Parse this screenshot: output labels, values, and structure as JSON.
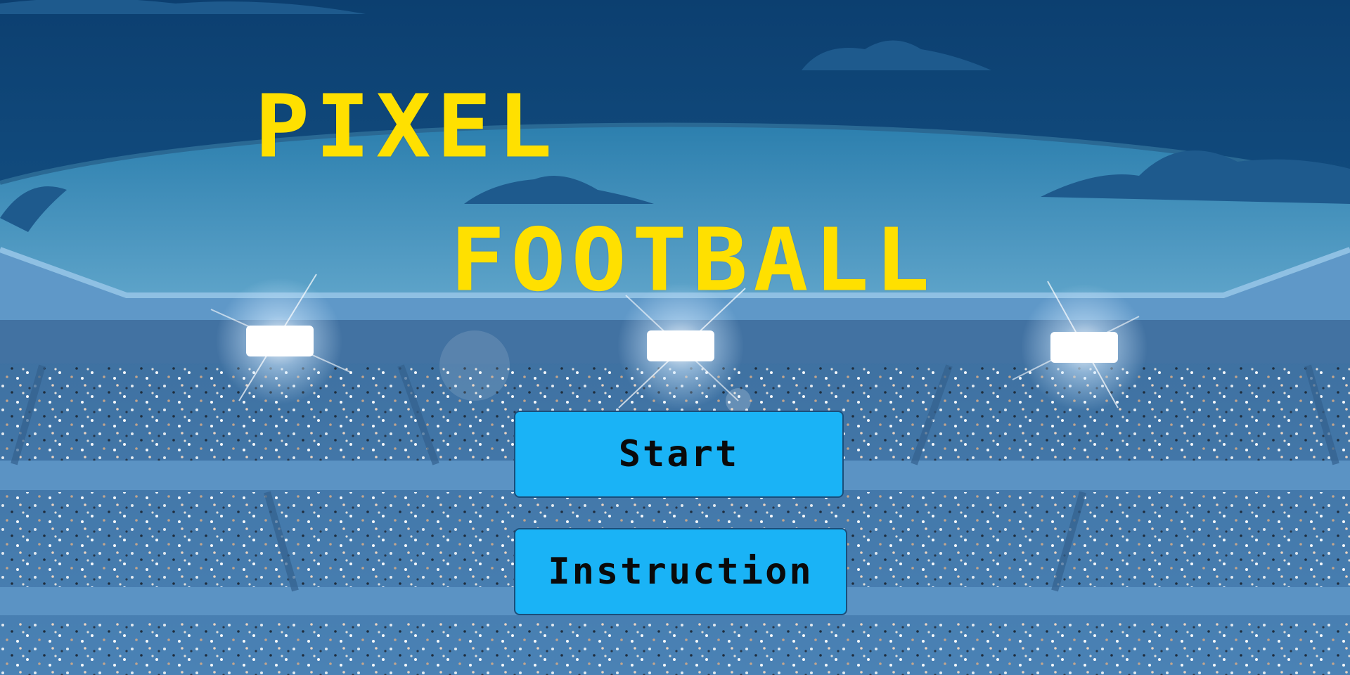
{
  "game": {
    "title_line_1": "PIXEL",
    "title_line_2": "FOOTBALL",
    "menu": {
      "start_label": "Start",
      "instruction_label": "Instruction"
    }
  },
  "colors": {
    "title": "#ffe000",
    "button_fill": "#1ab3f6",
    "button_border": "#1b4e7a",
    "button_text": "#0a0a0a",
    "sky_top": "#0d4a80",
    "stadium": "#4f86b8"
  },
  "icons": [
    "stadium-floodlight-icon",
    "cloud-icon",
    "crowd-background"
  ]
}
